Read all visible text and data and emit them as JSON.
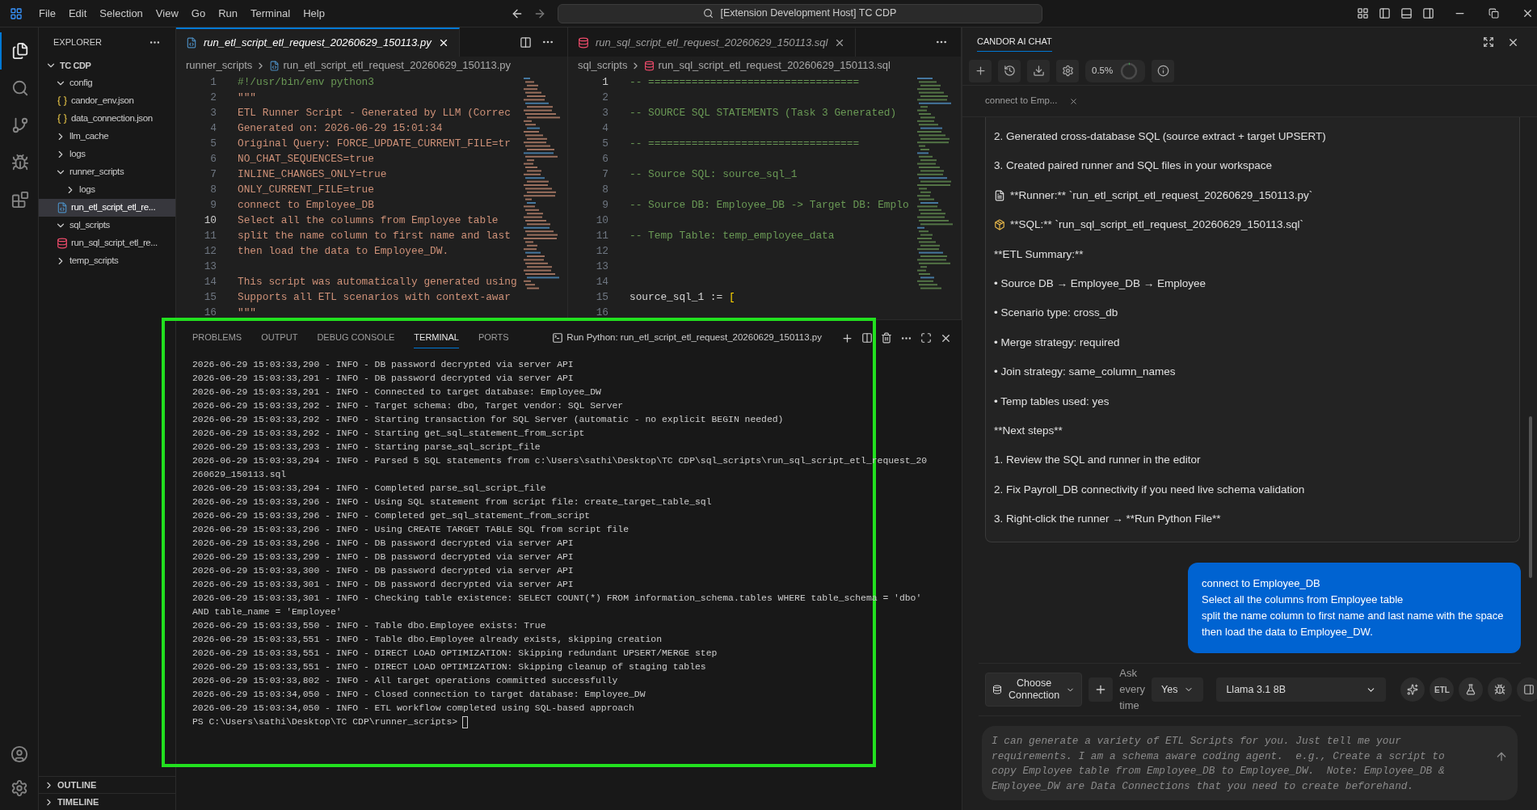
{
  "title_bar": {
    "menus": [
      "File",
      "Edit",
      "Selection",
      "View",
      "Go",
      "Run",
      "Terminal",
      "Help"
    ],
    "search": "[Extension Development Host] TC CDP"
  },
  "activity_bar": {
    "items": [
      {
        "kind": "files",
        "selected": true
      },
      {
        "kind": "search",
        "selected": false
      },
      {
        "kind": "source-control",
        "selected": false
      },
      {
        "kind": "run-debug",
        "selected": false
      },
      {
        "kind": "extensions",
        "selected": false
      }
    ],
    "bottom": [
      {
        "kind": "account"
      },
      {
        "kind": "settings"
      }
    ]
  },
  "explorer": {
    "title": "EXPLORER",
    "tree": [
      {
        "label": "TC CDP",
        "kind": "root",
        "expanded": true,
        "selected": false,
        "children": [
          {
            "label": "config",
            "kind": "folder",
            "expanded": true,
            "selected": false,
            "children": [
              {
                "label": "candor_env.json",
                "kind": "json",
                "selected": false
              },
              {
                "label": "data_connection.json",
                "kind": "json",
                "selected": false
              }
            ]
          },
          {
            "label": "llm_cache",
            "kind": "folder",
            "expanded": false,
            "selected": false
          },
          {
            "label": "logs",
            "kind": "folder",
            "expanded": false,
            "selected": false
          },
          {
            "label": "runner_scripts",
            "kind": "folder",
            "expanded": true,
            "selected": false,
            "children": [
              {
                "label": "logs",
                "kind": "folder",
                "expanded": false,
                "selected": false
              },
              {
                "label": "run_etl_script_etl_re...",
                "kind": "python",
                "selected": true
              }
            ]
          },
          {
            "label": "sql_scripts",
            "kind": "folder",
            "expanded": true,
            "selected": false,
            "children": [
              {
                "label": "run_sql_script_etl_re...",
                "kind": "sql",
                "selected": false
              }
            ]
          },
          {
            "label": "temp_scripts",
            "kind": "folder",
            "expanded": false,
            "selected": false
          }
        ]
      }
    ],
    "sections": [
      {
        "label": "OUTLINE",
        "expanded": false
      },
      {
        "label": "TIMELINE",
        "expanded": false
      }
    ]
  },
  "editors": [
    {
      "tab": {
        "label": "run_etl_script_etl_request_20260629_150113.py",
        "kind": "python",
        "selected": true
      },
      "breadcrumb": [
        {
          "label": "runner_scripts",
          "kind": "folder"
        },
        {
          "label": "run_etl_script_etl_request_20260629_150113.py",
          "kind": "python"
        }
      ],
      "lines": [
        {
          "n": "1",
          "current": false,
          "tokens": [
            {
              "text": "#!/usr/bin/env python3",
              "kind": "comment"
            }
          ]
        },
        {
          "n": "2",
          "current": false,
          "tokens": [
            {
              "text": "\"\"\"",
              "kind": "string"
            }
          ]
        },
        {
          "n": "3",
          "current": false,
          "tokens": [
            {
              "text": "ETL Runner Script - Generated by LLM (Correc",
              "kind": "string"
            }
          ]
        },
        {
          "n": "4",
          "current": false,
          "tokens": [
            {
              "text": "Generated on: 2026-06-29 15:01:34",
              "kind": "string"
            }
          ]
        },
        {
          "n": "5",
          "current": false,
          "tokens": [
            {
              "text": "Original Query: FORCE_UPDATE_CURRENT_FILE=tr",
              "kind": "string"
            }
          ]
        },
        {
          "n": "6",
          "current": false,
          "tokens": [
            {
              "text": "NO_CHAT_SEQUENCES=true",
              "kind": "string"
            }
          ]
        },
        {
          "n": "7",
          "current": false,
          "tokens": [
            {
              "text": "INLINE_CHANGES_ONLY=true",
              "kind": "string"
            }
          ]
        },
        {
          "n": "8",
          "current": false,
          "tokens": [
            {
              "text": "ONLY_CURRENT_FILE=true",
              "kind": "string"
            }
          ]
        },
        {
          "n": "9",
          "current": false,
          "tokens": [
            {
              "text": "connect to Employee_DB",
              "kind": "string"
            }
          ]
        },
        {
          "n": "10",
          "current": true,
          "tokens": [
            {
              "text": "Select all the columns from Employee table",
              "kind": "string"
            }
          ]
        },
        {
          "n": "11",
          "current": false,
          "tokens": [
            {
              "text": "split the name column to first name and last",
              "kind": "string"
            }
          ]
        },
        {
          "n": "12",
          "current": false,
          "tokens": [
            {
              "text": "then load the data to Employee_DW.",
              "kind": "string"
            }
          ]
        },
        {
          "n": "13",
          "current": false
        },
        {
          "n": "14",
          "current": false,
          "tokens": [
            {
              "text": "This script was automatically generated using",
              "kind": "string"
            }
          ]
        },
        {
          "n": "15",
          "current": false,
          "tokens": [
            {
              "text": "Supports all ETL scenarios with context-awar",
              "kind": "string"
            }
          ]
        },
        {
          "n": "16",
          "current": false,
          "tokens": [
            {
              "text": "\"\"\"",
              "kind": "string"
            }
          ]
        }
      ]
    },
    {
      "tab": {
        "label": "run_sql_script_etl_request_20260629_150113.sql",
        "kind": "sql",
        "selected": false
      },
      "breadcrumb": [
        {
          "label": "sql_scripts",
          "kind": "folder"
        },
        {
          "label": "run_sql_script_etl_request_20260629_150113.sql",
          "kind": "sql"
        }
      ],
      "lines": [
        {
          "n": "1",
          "current": true,
          "tokens": [
            {
              "text": "-- ==================================",
              "kind": "comment"
            }
          ]
        },
        {
          "n": "2",
          "current": false
        },
        {
          "n": "3",
          "current": false,
          "tokens": [
            {
              "text": "-- SOURCE SQL STATEMENTS (Task 3 Generated)",
              "kind": "comment"
            }
          ]
        },
        {
          "n": "4",
          "current": false
        },
        {
          "n": "5",
          "current": false,
          "tokens": [
            {
              "text": "-- ==================================",
              "kind": "comment"
            }
          ]
        },
        {
          "n": "6",
          "current": false
        },
        {
          "n": "7",
          "current": false,
          "tokens": [
            {
              "text": "-- Source SQL: source_sql_1",
              "kind": "comment"
            }
          ]
        },
        {
          "n": "8",
          "current": false
        },
        {
          "n": "9",
          "current": false,
          "tokens": [
            {
              "text": "-- Source DB: Employee_DB -> Target DB: Emplo",
              "kind": "comment"
            }
          ]
        },
        {
          "n": "10",
          "current": false
        },
        {
          "n": "11",
          "current": false,
          "tokens": [
            {
              "text": "-- Temp Table: temp_employee_data",
              "kind": "comment"
            }
          ]
        },
        {
          "n": "12",
          "current": false
        },
        {
          "n": "13",
          "current": false
        },
        {
          "n": "14",
          "current": false
        },
        {
          "n": "15",
          "current": false,
          "tokens": [
            {
              "text": "source_sql_1 := ",
              "kind": "plain"
            },
            {
              "text": "[",
              "kind": "bracket"
            }
          ]
        },
        {
          "n": "16",
          "current": false
        }
      ]
    }
  ],
  "panel": {
    "tabs": [
      {
        "label": "PROBLEMS",
        "selected": false
      },
      {
        "label": "OUTPUT",
        "selected": false
      },
      {
        "label": "DEBUG CONSOLE",
        "selected": false
      },
      {
        "label": "TERMINAL",
        "selected": true
      },
      {
        "label": "PORTS",
        "selected": false
      }
    ],
    "terminal_title": "Run Python: run_etl_script_etl_request_20260629_150113.py",
    "lines": [
      "2026-06-29 15:03:33,290 - INFO - DB password decrypted via server API",
      "2026-06-29 15:03:33,291 - INFO - DB password decrypted via server API",
      "2026-06-29 15:03:33,291 - INFO - Connected to target database: Employee_DW",
      "2026-06-29 15:03:33,292 - INFO - Target schema: dbo, Target vendor: SQL Server",
      "2026-06-29 15:03:33,292 - INFO - Starting transaction for SQL Server (automatic - no explicit BEGIN needed)",
      "2026-06-29 15:03:33,292 - INFO - Starting get_sql_statement_from_script",
      "2026-06-29 15:03:33,293 - INFO - Starting parse_sql_script_file",
      "2026-06-29 15:03:33,294 - INFO - Parsed 5 SQL statements from c:\\Users\\sathi\\Desktop\\TC CDP\\sql_scripts\\run_sql_script_etl_request_20",
      "260629_150113.sql",
      "2026-06-29 15:03:33,294 - INFO - Completed parse_sql_script_file",
      "2026-06-29 15:03:33,296 - INFO - Using SQL statement from script file: create_target_table_sql",
      "2026-06-29 15:03:33,296 - INFO - Completed get_sql_statement_from_script",
      "2026-06-29 15:03:33,296 - INFO - Using CREATE TARGET TABLE SQL from script file",
      "2026-06-29 15:03:33,296 - INFO - DB password decrypted via server API",
      "2026-06-29 15:03:33,299 - INFO - DB password decrypted via server API",
      "2026-06-29 15:03:33,300 - INFO - DB password decrypted via server API",
      "2026-06-29 15:03:33,301 - INFO - DB password decrypted via server API",
      "2026-06-29 15:03:33,301 - INFO - Checking table existence: SELECT COUNT(*) FROM information_schema.tables WHERE table_schema = 'dbo'",
      "AND table_name = 'Employee'",
      "2026-06-29 15:03:33,550 - INFO - Table dbo.Employee exists: True",
      "2026-06-29 15:03:33,551 - INFO - Table dbo.Employee already exists, skipping creation",
      "2026-06-29 15:03:33,551 - INFO - DIRECT LOAD OPTIMIZATION: Skipping redundant UPSERT/MERGE step",
      "2026-06-29 15:03:33,551 - INFO - DIRECT LOAD OPTIMIZATION: Skipping cleanup of staging tables",
      "2026-06-29 15:03:33,802 - INFO - All target operations committed successfully",
      "2026-06-29 15:03:34,050 - INFO - Closed connection to target database: Employee_DW",
      "2026-06-29 15:03:34,050 - INFO - ETL workflow completed using SQL-based approach"
    ],
    "prompt": "PS C:\\Users\\sathi\\Desktop\\TC CDP\\runner_scripts>"
  },
  "chat": {
    "title": "CANDOR AI CHAT",
    "usage": "0.5%",
    "level": 0.005,
    "session_tab": "connect to Emp...",
    "assistant_lines": [
      {
        "text": "2. Generated cross-database SQL (source extract + target UPSERT)"
      },
      {
        "text": "3. Created paired runner and SQL files in your workspace"
      },
      {
        "text": "**Runner:** `run_etl_script_etl_request_20260629_150113.py`",
        "kind": "document"
      },
      {
        "text": "**SQL:** `run_sql_script_etl_request_20260629_150113.sql`",
        "kind": "package"
      },
      {
        "text": "**ETL Summary:**"
      },
      {
        "text": "• Source DB → Employee_DB → Employee"
      },
      {
        "text": "• Scenario type: cross_db"
      },
      {
        "text": "• Merge strategy: required"
      },
      {
        "text": "• Join strategy: same_column_names"
      },
      {
        "text": "• Temp tables used: yes"
      },
      {
        "text": "**Next steps**"
      },
      {
        "text": "1. Review the SQL and runner in the editor"
      },
      {
        "text": "2. Fix Payroll_DB connectivity if you need live schema validation"
      },
      {
        "text": "3. Right-click the runner → **Run Python File**"
      }
    ],
    "user_message": [
      "connect to Employee_DB",
      "Select all the columns from Employee table",
      "split the name column to first name and last name with the space",
      "then load the data to Employee_DW."
    ],
    "connection": "Choose Connection",
    "ask_label": "Ask every time",
    "ask_value": "Yes",
    "model": "Llama 3.1 8B",
    "tool_buttons": [
      {
        "kind": "sparkle"
      },
      {
        "kind": "text",
        "label": "ETL"
      },
      {
        "kind": "flask"
      },
      {
        "kind": "bug"
      },
      {
        "kind": "panel"
      }
    ],
    "placeholder": "I can generate a variety of ETL Scripts for you. Just tell me your requirements. I am a schema aware coding agent.  e.g., Create a script to copy Employee table from Employee_DB to Employee_DW.  Note: Employee_DB & Employee_DW are Data Connections that you need to create beforehand."
  }
}
